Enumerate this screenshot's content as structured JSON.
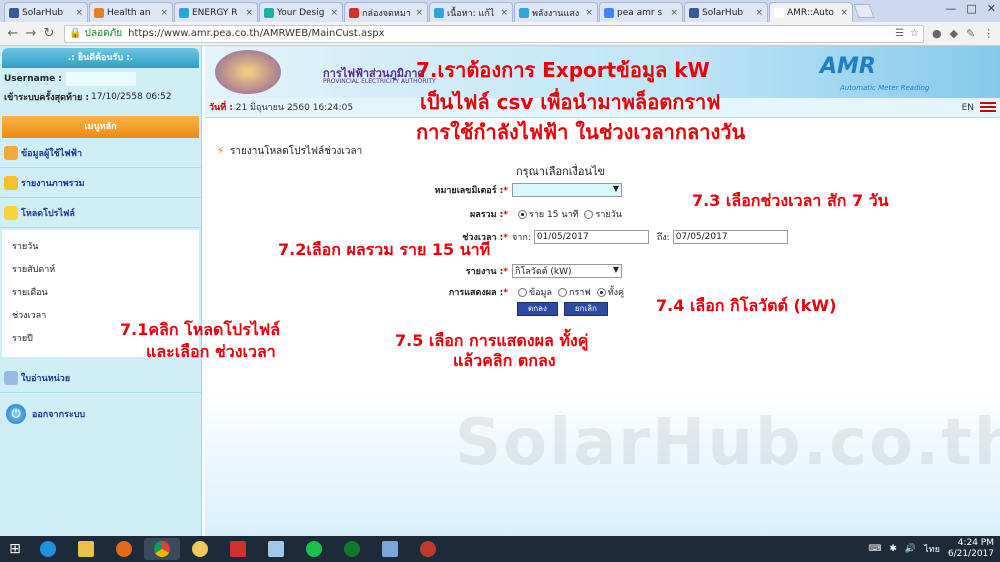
{
  "browser": {
    "tabs": [
      {
        "label": "SolarHub",
        "color": "#3b5998"
      },
      {
        "label": "Health an",
        "color": "#e67e22"
      },
      {
        "label": "ENERGY R",
        "color": "#2aa7d8"
      },
      {
        "label": "Your Desig",
        "color": "#17b6a3"
      },
      {
        "label": "กล่องจดหมา",
        "color": "#d93025"
      },
      {
        "label": "เนื้อหา: แก้ไ",
        "color": "#2aa7d8"
      },
      {
        "label": "พลังงานแสง",
        "color": "#2aa7d8"
      },
      {
        "label": "pea amr s",
        "color": "#4285f4"
      },
      {
        "label": "SolarHub",
        "color": "#3b5998"
      },
      {
        "label": "AMR::Auto",
        "color": "#ffffff"
      }
    ],
    "secure_label": "ปลอดภัย",
    "url": "https://www.amr.pea.co.th/AMRWEB/MainCust.aspx"
  },
  "sidebar": {
    "welcome": ".: ยินดีต้อนรับ :.",
    "username_label": "Username :",
    "last_login_label": "เข้าระบบครั้งสุดท้าย :",
    "last_login_value": "17/10/2558 06:52",
    "menu_header": "เมนูหลัก",
    "items": [
      {
        "label": "ข้อมูลผู้ใช้ไฟฟ้า"
      },
      {
        "label": "รายงานภาพรวม"
      },
      {
        "label": "โหลดโปรไฟล์"
      }
    ],
    "submenu": [
      "รายวัน",
      "รายสัปดาห์",
      "รายเดือน",
      "ช่วงเวลา",
      "รายปี"
    ],
    "invoice": "ใบอ่านหน่วย",
    "logout": "ออกจากระบบ"
  },
  "banner": {
    "org_name": "การไฟฟ้าส่วนภูมิภาค",
    "org_name_en": "PROVINCIAL ELECTRICITY AUTHORITY",
    "amr_logo": "AMR",
    "amr_sub": "Automatic Meter Reading",
    "date_label": "วันที่ :",
    "date_value": "21 มิถุนายน 2560 16:24:05",
    "lang": "EN"
  },
  "report": {
    "title": "รายงานโหลดโปรไฟล์ช่วงเวลา",
    "form_heading": "กรุณาเลือกเงื่อนไข",
    "meter_label": "หมายเลขมิเตอร์ :",
    "sum_label": "ผลรวม :",
    "sum_options": [
      "ราย 15 นาที",
      "รายวัน"
    ],
    "period_label": "ช่วงเวลา :",
    "from_label": "จาก:",
    "from_value": "01/05/2017",
    "to_label": "ถึง:",
    "to_value": "07/05/2017",
    "report_label": "รายงาน :",
    "report_value": "กิโลวัตต์ (kW)",
    "display_label": "การแสดงผล :",
    "display_options": [
      "ข้อมูล",
      "กราฟ",
      "ทั้งคู่"
    ],
    "ok_button": "ตกลง",
    "cancel_button": "ยกเลิก"
  },
  "annotations": {
    "headline_1": "7.เราต้องการ Exportข้อมูล kW",
    "headline_2": "เป็นไฟล์ csv เพื่อนำมาพล็อตกราฟ",
    "headline_3": "การใช้กำลังไฟฟ้า ในช่วงเวลากลางวัน",
    "step_7_1a": "7.1คลิก โหลดโปรไฟล์",
    "step_7_1b": "และเลือก ช่วงเวลา",
    "step_7_2": "7.2เลือก ผลรวม ราย 15 นาที",
    "step_7_3": "7.3 เลือกช่วงเวลา สัก 7 วัน",
    "step_7_4": "7.4 เลือก กิโลวัตต์ (kW)",
    "step_7_5a": "7.5 เลือก การแสดงผล ทั้งคู่",
    "step_7_5b": "แล้วคลิก ตกลง",
    "watermark": "SolarHub.co.th"
  },
  "taskbar": {
    "time": "4:24 PM",
    "date": "6/21/2017",
    "ime": "ไทย"
  }
}
